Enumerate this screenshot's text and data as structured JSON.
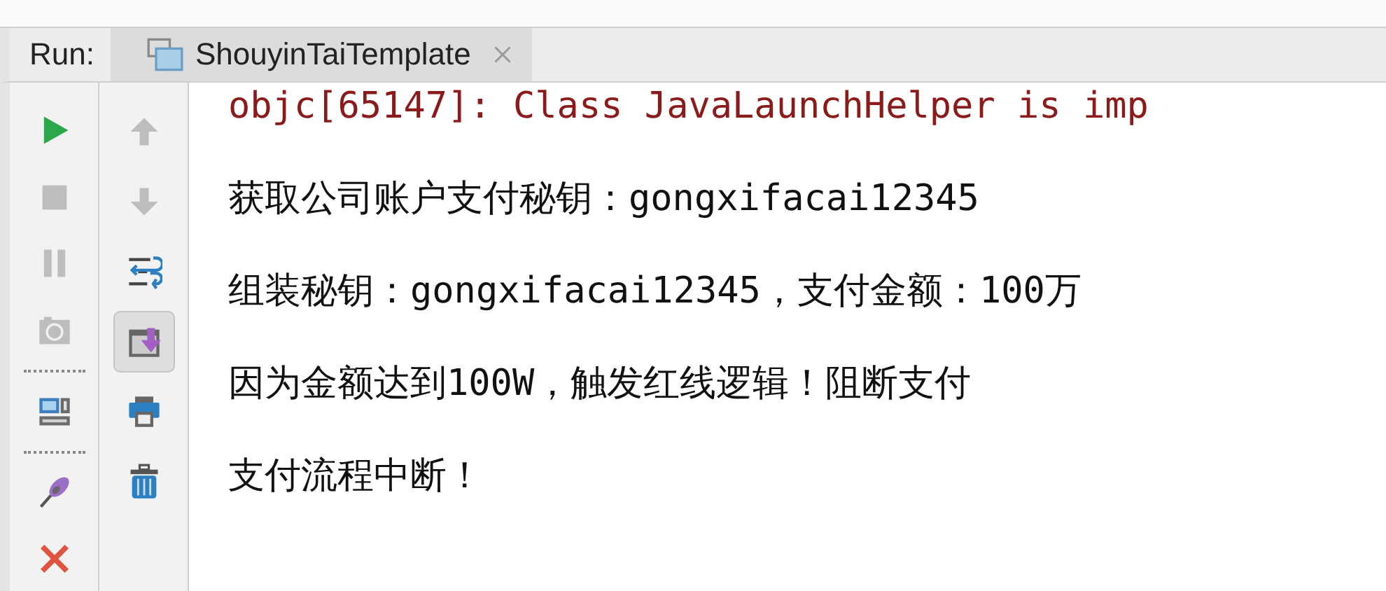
{
  "run_panel": {
    "label": "Run:",
    "tabs": [
      {
        "title": "ShouyinTaiTemplate",
        "selected": true
      }
    ]
  },
  "left_toolbar": [
    {
      "kind": "run",
      "disabled": false
    },
    {
      "kind": "stop",
      "disabled": true
    },
    {
      "kind": "pause",
      "disabled": true
    },
    {
      "kind": "camera",
      "disabled": true
    },
    {
      "kind": "separator"
    },
    {
      "kind": "layout",
      "disabled": false
    },
    {
      "kind": "separator"
    },
    {
      "kind": "pin",
      "disabled": false
    },
    {
      "kind": "close",
      "disabled": false
    }
  ],
  "right_toolbar": [
    {
      "kind": "up",
      "disabled": true,
      "selected": false
    },
    {
      "kind": "down",
      "disabled": true,
      "selected": false
    },
    {
      "kind": "wrap",
      "disabled": false,
      "selected": false
    },
    {
      "kind": "scroll-end",
      "disabled": false,
      "selected": true
    },
    {
      "kind": "print",
      "disabled": false,
      "selected": false
    },
    {
      "kind": "trash",
      "disabled": false,
      "selected": false
    }
  ],
  "console_lines": [
    {
      "text": "objc[65147]: Class JavaLaunchHelper is imp",
      "kind": "error"
    },
    {
      "text": "获取公司账户支付秘钥：gongxifacai12345",
      "kind": "output"
    },
    {
      "text": "组装秘钥：gongxifacai12345，支付金额：100万",
      "kind": "output"
    },
    {
      "text": "因为金额达到100W，触发红线逻辑！阻断支付",
      "kind": "output"
    },
    {
      "text": "支付流程中断！",
      "kind": "output"
    }
  ]
}
